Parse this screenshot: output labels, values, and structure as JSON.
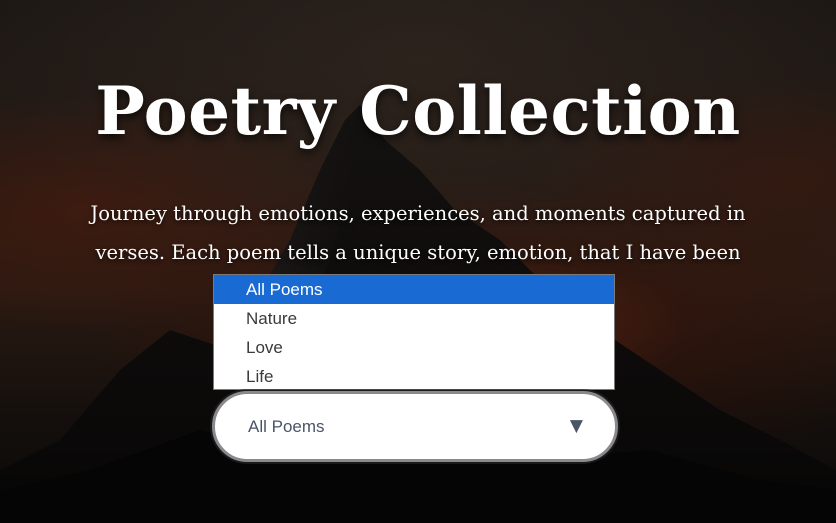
{
  "header": {
    "title": "Poetry Collection",
    "subtitle": "Journey through emotions, experiences, and moments captured in verses. Each poem tells a unique story, emotion, that I have been"
  },
  "filter": {
    "selected_label": "All Poems",
    "arrow": "▼",
    "arrow_icon": "triangle-down-icon",
    "options": [
      {
        "label": "All Poems",
        "selected": true
      },
      {
        "label": "Nature",
        "selected": false
      },
      {
        "label": "Love",
        "selected": false
      },
      {
        "label": "Life",
        "selected": false
      }
    ]
  },
  "colors": {
    "selected_option_bg": "#1a6ad4",
    "text_on_dark": "#ffffff",
    "select_text": "#4a5568"
  }
}
